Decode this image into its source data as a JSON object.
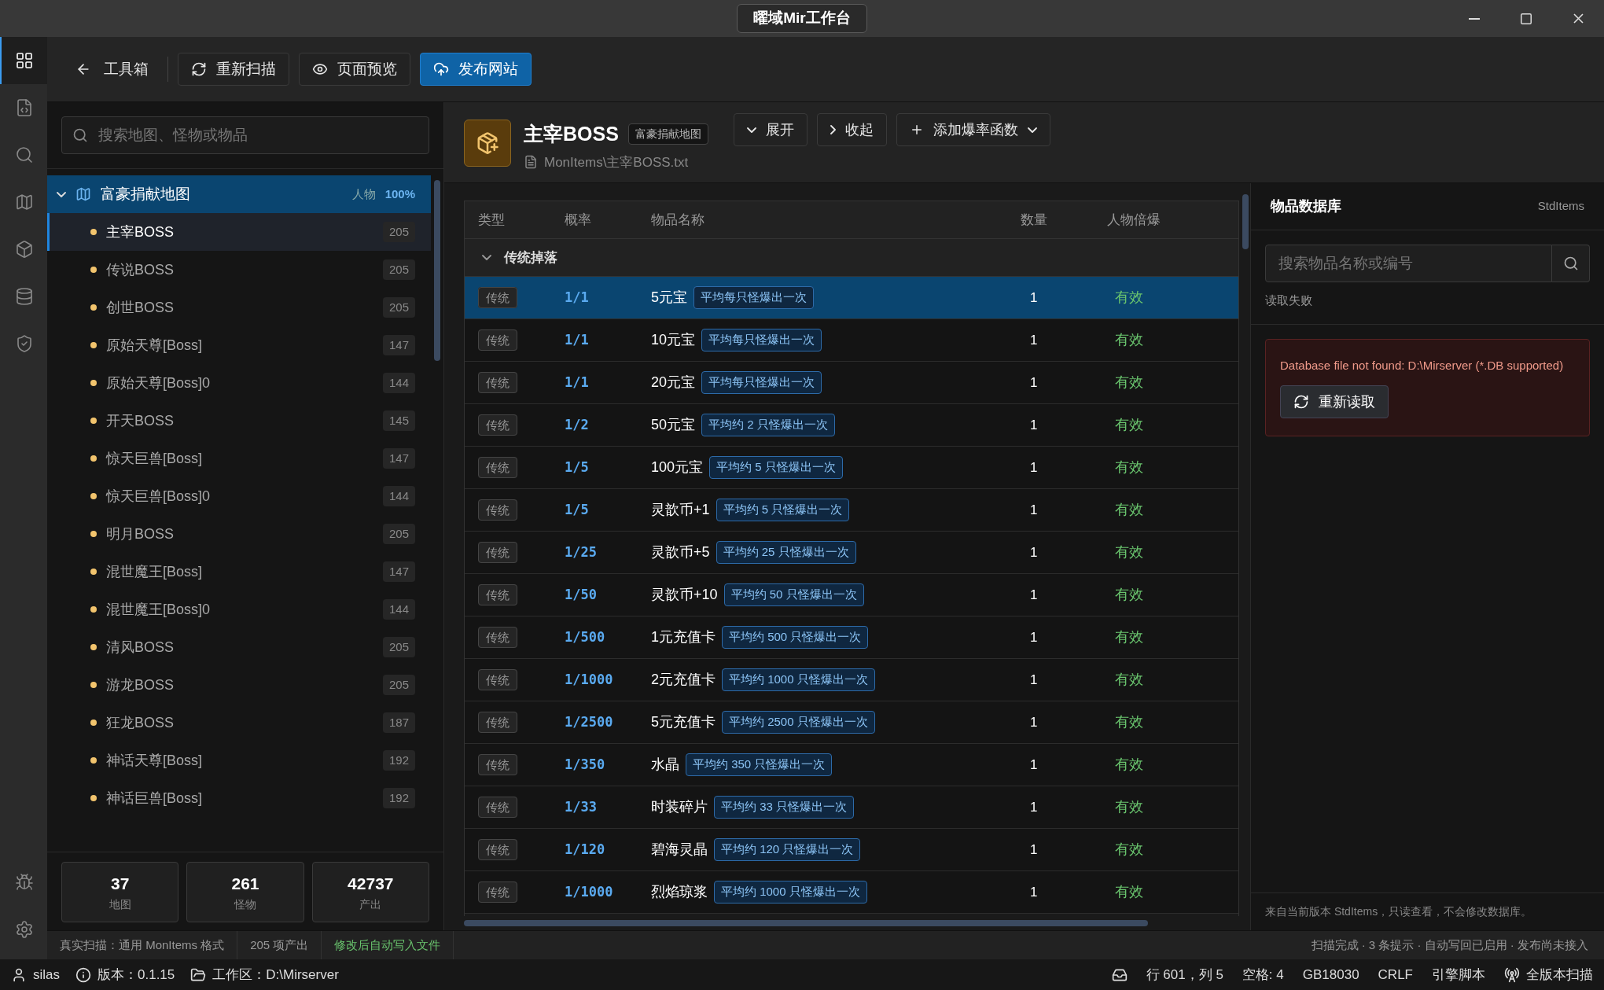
{
  "window": {
    "title": "曜域Mir工作台"
  },
  "activity_bar": {
    "top": [
      {
        "selected": true
      },
      {
        "selected": false
      },
      {
        "selected": false
      },
      {
        "selected": false
      },
      {
        "selected": false
      },
      {
        "selected": false
      },
      {
        "selected": false
      }
    ],
    "bottom": [
      {
        "selected": false
      },
      {
        "selected": false
      }
    ]
  },
  "toolbar": {
    "back": "工具箱",
    "buttons": [
      {
        "label": "重新扫描",
        "primary": false
      },
      {
        "label": "页面预览",
        "primary": false
      },
      {
        "label": "发布网站",
        "primary": true
      }
    ]
  },
  "sidebar": {
    "search": {
      "placeholder": "搜索地图、怪物或物品"
    },
    "tree": {
      "label": "富豪捐献地图",
      "expanded": true,
      "meta_label": "人物",
      "meta_value": "100%",
      "children": [
        {
          "label": "主宰BOSS",
          "count": "205",
          "selected": true
        },
        {
          "label": "传说BOSS",
          "count": "205",
          "selected": false
        },
        {
          "label": "创世BOSS",
          "count": "205",
          "selected": false
        },
        {
          "label": "原始天尊[Boss]",
          "count": "147",
          "selected": false
        },
        {
          "label": "原始天尊[Boss]0",
          "count": "144",
          "selected": false
        },
        {
          "label": "开天BOSS",
          "count": "145",
          "selected": false
        },
        {
          "label": "惊天巨兽[Boss]",
          "count": "147",
          "selected": false
        },
        {
          "label": "惊天巨兽[Boss]0",
          "count": "144",
          "selected": false
        },
        {
          "label": "明月BOSS",
          "count": "205",
          "selected": false
        },
        {
          "label": "混世魔王[Boss]",
          "count": "147",
          "selected": false
        },
        {
          "label": "混世魔王[Boss]0",
          "count": "144",
          "selected": false
        },
        {
          "label": "清风BOSS",
          "count": "205",
          "selected": false
        },
        {
          "label": "游龙BOSS",
          "count": "205",
          "selected": false
        },
        {
          "label": "狂龙BOSS",
          "count": "187",
          "selected": false
        },
        {
          "label": "神话天尊[Boss]",
          "count": "192",
          "selected": false
        },
        {
          "label": "神话巨兽[Boss]",
          "count": "192",
          "selected": false
        }
      ]
    },
    "stats": [
      {
        "value": "37",
        "label": "地图"
      },
      {
        "value": "261",
        "label": "怪物"
      },
      {
        "value": "42737",
        "label": "产出"
      }
    ]
  },
  "editor": {
    "title": "主宰BOSS",
    "map_tag": "富豪捐献地图",
    "path": "MonItems\\主宰BOSS.txt",
    "buttons": [
      {
        "label": "展开",
        "kind": "expand"
      },
      {
        "label": "收起",
        "kind": "collapse"
      },
      {
        "label": "添加爆率函数",
        "kind": "add"
      }
    ]
  },
  "table": {
    "columns": [
      "类型",
      "概率",
      "物品名称",
      "数量",
      "人物倍爆"
    ],
    "group": {
      "label": "传统掉落",
      "expanded": true
    },
    "rows": [
      {
        "type": "传统",
        "rate": "1/1",
        "name": "5元宝",
        "hint": "平均每只怪爆出一次",
        "qty": "1",
        "bonus": "有效",
        "selected": true
      },
      {
        "type": "传统",
        "rate": "1/1",
        "name": "10元宝",
        "hint": "平均每只怪爆出一次",
        "qty": "1",
        "bonus": "有效",
        "selected": false
      },
      {
        "type": "传统",
        "rate": "1/1",
        "name": "20元宝",
        "hint": "平均每只怪爆出一次",
        "qty": "1",
        "bonus": "有效",
        "selected": false
      },
      {
        "type": "传统",
        "rate": "1/2",
        "name": "50元宝",
        "hint": "平均约 2 只怪爆出一次",
        "qty": "1",
        "bonus": "有效",
        "selected": false
      },
      {
        "type": "传统",
        "rate": "1/5",
        "name": "100元宝",
        "hint": "平均约 5 只怪爆出一次",
        "qty": "1",
        "bonus": "有效",
        "selected": false
      },
      {
        "type": "传统",
        "rate": "1/5",
        "name": "灵歆币+1",
        "hint": "平均约 5 只怪爆出一次",
        "qty": "1",
        "bonus": "有效",
        "selected": false
      },
      {
        "type": "传统",
        "rate": "1/25",
        "name": "灵歆币+5",
        "hint": "平均约 25 只怪爆出一次",
        "qty": "1",
        "bonus": "有效",
        "selected": false
      },
      {
        "type": "传统",
        "rate": "1/50",
        "name": "灵歆币+10",
        "hint": "平均约 50 只怪爆出一次",
        "qty": "1",
        "bonus": "有效",
        "selected": false
      },
      {
        "type": "传统",
        "rate": "1/500",
        "name": "1元充值卡",
        "hint": "平均约 500 只怪爆出一次",
        "qty": "1",
        "bonus": "有效",
        "selected": false
      },
      {
        "type": "传统",
        "rate": "1/1000",
        "name": "2元充值卡",
        "hint": "平均约 1000 只怪爆出一次",
        "qty": "1",
        "bonus": "有效",
        "selected": false
      },
      {
        "type": "传统",
        "rate": "1/2500",
        "name": "5元充值卡",
        "hint": "平均约 2500 只怪爆出一次",
        "qty": "1",
        "bonus": "有效",
        "selected": false
      },
      {
        "type": "传统",
        "rate": "1/350",
        "name": "水晶",
        "hint": "平均约 350 只怪爆出一次",
        "qty": "1",
        "bonus": "有效",
        "selected": false
      },
      {
        "type": "传统",
        "rate": "1/33",
        "name": "时装碎片",
        "hint": "平均约 33 只怪爆出一次",
        "qty": "1",
        "bonus": "有效",
        "selected": false
      },
      {
        "type": "传统",
        "rate": "1/120",
        "name": "碧海灵晶",
        "hint": "平均约 120 只怪爆出一次",
        "qty": "1",
        "bonus": "有效",
        "selected": false
      },
      {
        "type": "传统",
        "rate": "1/1000",
        "name": "烈焰琼浆",
        "hint": "平均约 1000 只怪爆出一次",
        "qty": "1",
        "bonus": "有效",
        "selected": false
      }
    ]
  },
  "item_db": {
    "title": "物品数据库",
    "source": "StdItems",
    "search": {
      "placeholder": "搜索物品名称或编号"
    },
    "status": "读取失败",
    "error": "Database file not found: D:\\Mirserver (*.DB supported)",
    "retry": "重新读取",
    "footer": "来自当前版本 StdItems，只读查看，不会修改数据库。"
  },
  "scan_bar": {
    "left": [
      {
        "text": "真实扫描：通用 MonItems 格式",
        "kind": "plain"
      },
      {
        "text": "205 项产出",
        "kind": "plain"
      },
      {
        "text": "修改后自动写入文件",
        "kind": "ok"
      }
    ],
    "right": "扫描完成 · 3 条提示 · 自动写回已启用 · 发布尚未接入"
  },
  "status_bar": {
    "user": "silas",
    "version": "版本：0.1.15",
    "workspace": "工作区：D:\\Mirserver",
    "position": "行 601，列 5",
    "indent": "空格: 4",
    "encoding": "GB18030",
    "eol": "CRLF",
    "language": "引擎脚本",
    "scan": "全版本扫描"
  }
}
